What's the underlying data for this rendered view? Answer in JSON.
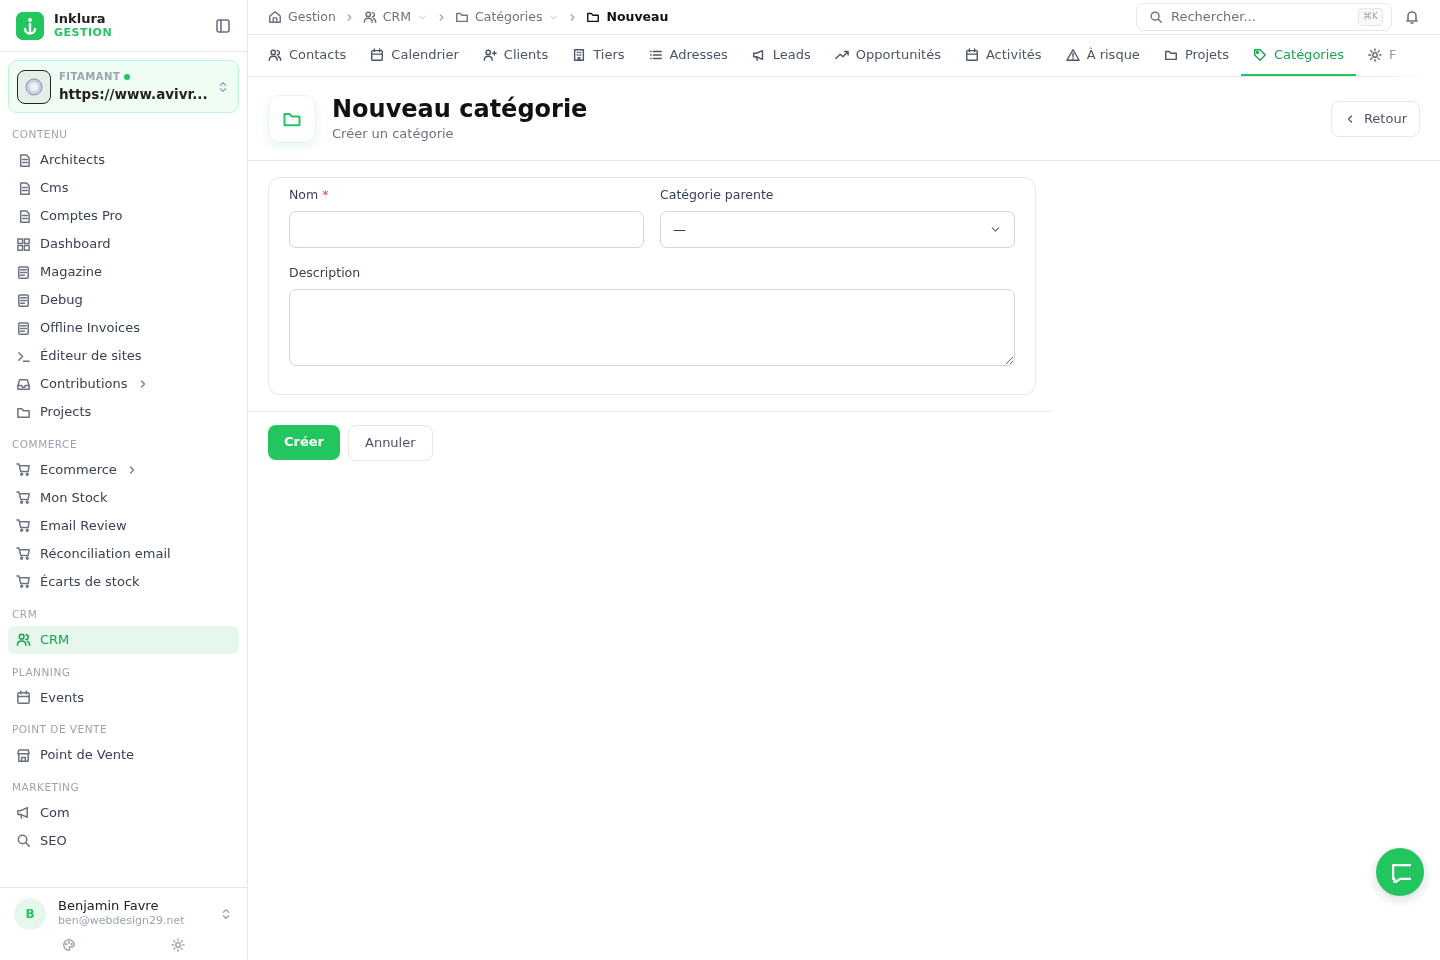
{
  "brand": {
    "name": "Inklura",
    "subtitle": "GESTION"
  },
  "workspace": {
    "label": "FITAMANT",
    "online": true,
    "url": "https://www.avivr..."
  },
  "sidebar": {
    "sections": [
      {
        "title": "CONTENU",
        "items": [
          {
            "label": "Architects",
            "kind": "doc",
            "selected": false
          },
          {
            "label": "Cms",
            "kind": "doc",
            "selected": false
          },
          {
            "label": "Comptes Pro",
            "kind": "doc",
            "selected": false
          },
          {
            "label": "Dashboard",
            "kind": "grid",
            "selected": false
          },
          {
            "label": "Magazine",
            "kind": "news",
            "selected": false
          },
          {
            "label": "Debug",
            "kind": "news",
            "selected": false
          },
          {
            "label": "Offline Invoices",
            "kind": "news",
            "selected": false
          },
          {
            "label": "Éditeur de sites",
            "kind": "terminal",
            "selected": false
          },
          {
            "label": "Contributions",
            "kind": "inbox",
            "selected": false,
            "submenu": true
          },
          {
            "label": "Projects",
            "kind": "folder",
            "selected": false
          }
        ]
      },
      {
        "title": "COMMERCE",
        "items": [
          {
            "label": "Ecommerce",
            "kind": "cart",
            "selected": false,
            "submenu": true
          },
          {
            "label": "Mon Stock",
            "kind": "cart",
            "selected": false
          },
          {
            "label": "Email Review",
            "kind": "cart",
            "selected": false
          },
          {
            "label": "Réconciliation email",
            "kind": "cart",
            "selected": false
          },
          {
            "label": "Écarts de stock",
            "kind": "cart",
            "selected": false
          }
        ]
      },
      {
        "title": "CRM",
        "items": [
          {
            "label": "CRM",
            "kind": "users",
            "selected": true
          }
        ]
      },
      {
        "title": "PLANNING",
        "items": [
          {
            "label": "Events",
            "kind": "calendar",
            "selected": false
          }
        ]
      },
      {
        "title": "POINT DE VENTE",
        "items": [
          {
            "label": "Point de Vente",
            "kind": "store",
            "selected": false
          }
        ]
      },
      {
        "title": "MARKETING",
        "items": [
          {
            "label": "Com",
            "kind": "megaphone",
            "selected": false
          },
          {
            "label": "SEO",
            "kind": "search",
            "selected": false
          }
        ]
      }
    ]
  },
  "user": {
    "initial": "B",
    "name": "Benjamin Favre",
    "email": "ben@webdesign29.net"
  },
  "breadcrumbs": [
    {
      "label": "Gestion",
      "kind": "home",
      "dropdown": false,
      "current": false
    },
    {
      "label": "CRM",
      "kind": "users",
      "dropdown": true,
      "current": false
    },
    {
      "label": "Catégories",
      "kind": "folder",
      "dropdown": true,
      "current": false
    },
    {
      "label": "Nouveau",
      "kind": "folder",
      "dropdown": false,
      "current": true
    }
  ],
  "search": {
    "placeholder": "Rechercher...",
    "shortcut": "⌘K"
  },
  "tabs": [
    {
      "label": "Contacts",
      "kind": "users",
      "selected": false
    },
    {
      "label": "Calendrier",
      "kind": "calendar",
      "selected": false
    },
    {
      "label": "Clients",
      "kind": "userplus",
      "selected": false
    },
    {
      "label": "Tiers",
      "kind": "building",
      "selected": false
    },
    {
      "label": "Adresses",
      "kind": "list",
      "selected": false
    },
    {
      "label": "Leads",
      "kind": "megaphone",
      "selected": false
    },
    {
      "label": "Opportunités",
      "kind": "trend",
      "selected": false
    },
    {
      "label": "Activités",
      "kind": "calendar",
      "selected": false
    },
    {
      "label": "À risque",
      "kind": "warning",
      "selected": false
    },
    {
      "label": "Projets",
      "kind": "folder",
      "selected": false
    },
    {
      "label": "Catégories",
      "kind": "tag",
      "selected": true
    },
    {
      "label": "F",
      "kind": "gear",
      "selected": false
    }
  ],
  "header": {
    "title": "Nouveau catégorie",
    "subtitle": "Créer un catégorie",
    "back": "Retour"
  },
  "form": {
    "fields": [
      {
        "label": "Nom",
        "required_mark": "*",
        "kind": "text"
      },
      {
        "label": "Catégorie parente",
        "kind": "select",
        "value": "—"
      },
      {
        "label": "Description",
        "kind": "textarea"
      }
    ]
  },
  "actions": [
    {
      "label": "Créer",
      "kind": "primary"
    },
    {
      "label": "Annuler",
      "kind": "secondary"
    }
  ]
}
